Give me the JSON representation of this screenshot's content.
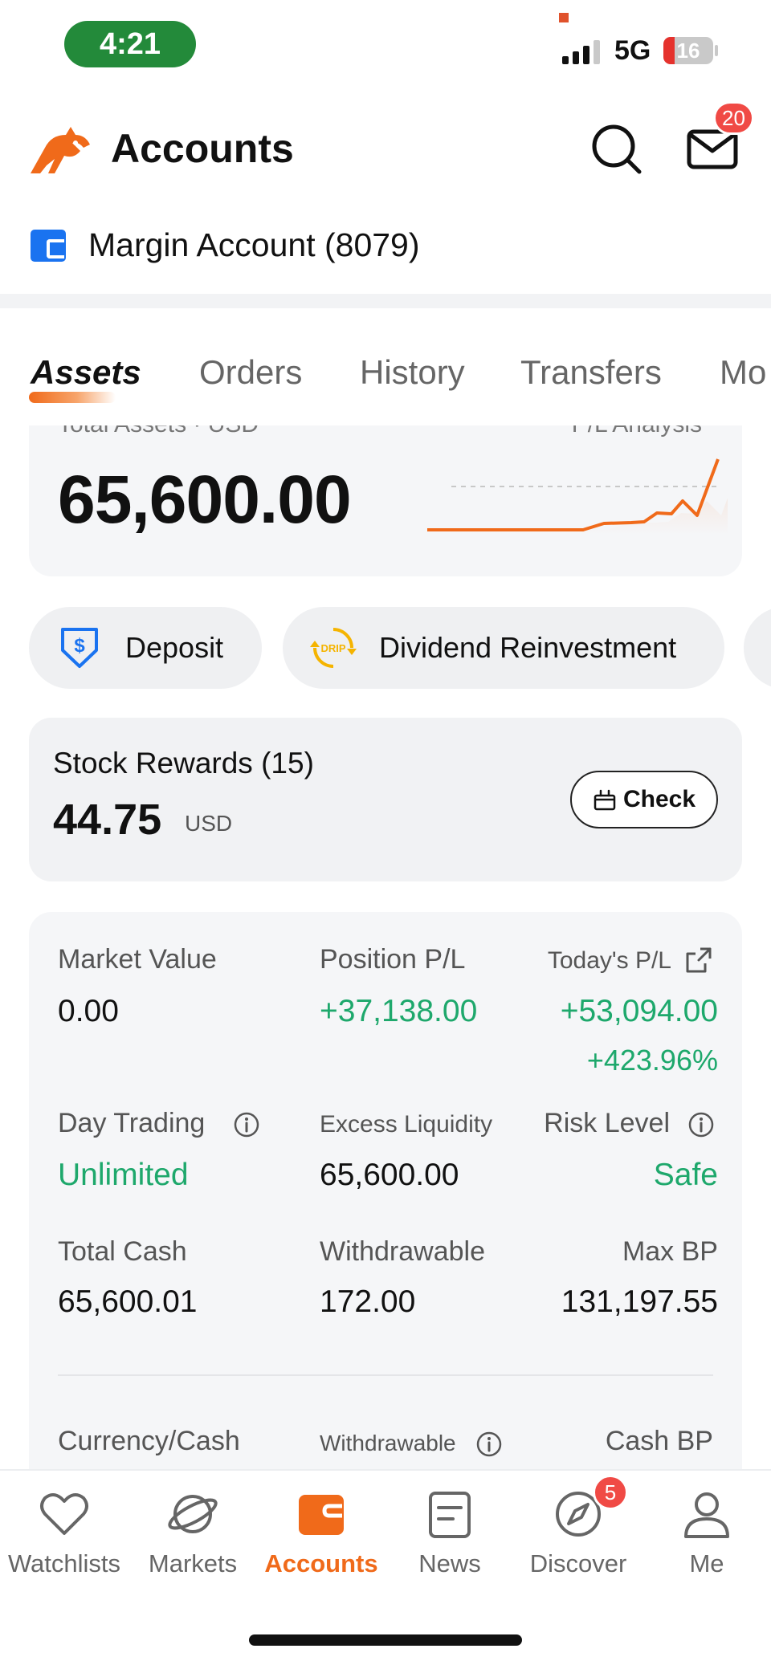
{
  "status_bar": {
    "time": "4:21",
    "network": "5G",
    "battery": "16"
  },
  "header": {
    "title": "Accounts",
    "mail_badge": "20"
  },
  "account": {
    "label": "Margin Account (8079)"
  },
  "tabs": [
    {
      "label": "Assets",
      "active": true
    },
    {
      "label": "Orders",
      "active": false
    },
    {
      "label": "History",
      "active": false
    },
    {
      "label": "Transfers",
      "active": false
    },
    {
      "label": "Mo",
      "active": false
    }
  ],
  "assets_card": {
    "total_label": "Total Assets · USD",
    "analysis_label": "P/L Analysis",
    "total_value": "65,600.00"
  },
  "quick_actions": [
    {
      "label": "Deposit",
      "icon": "deposit-icon"
    },
    {
      "label": "Dividend Reinvestment",
      "icon": "drip-icon",
      "icon_text": "DRIP"
    }
  ],
  "stock_rewards": {
    "title": "Stock Rewards (15)",
    "amount": "44.75",
    "currency": "USD",
    "button_label": "Check"
  },
  "metrics": {
    "market_value": {
      "label": "Market Value",
      "value": "0.00"
    },
    "position_pl": {
      "label": "Position P/L",
      "value": "+37,138.00"
    },
    "todays_pl": {
      "label": "Today's P/L",
      "value": "+53,094.00",
      "percent": "+423.96%"
    },
    "day_trading": {
      "label": "Day Trading",
      "value": "Unlimited"
    },
    "excess_liquidity": {
      "label": "Excess Liquidity",
      "value": "65,600.00"
    },
    "risk_level": {
      "label": "Risk Level",
      "value": "Safe"
    },
    "total_cash": {
      "label": "Total Cash",
      "value": "65,600.01"
    },
    "withdrawable": {
      "label": "Withdrawable",
      "value": "172.00"
    },
    "max_bp": {
      "label": "Max BP",
      "value": "131,197.55"
    },
    "currency_cash": {
      "label": "Currency/Cash"
    },
    "withdrawable_2": {
      "label": "Withdrawable"
    },
    "cash_bp": {
      "label": "Cash BP"
    }
  },
  "bottom_nav": [
    {
      "label": "Watchlists",
      "icon": "heart-icon",
      "active": false
    },
    {
      "label": "Markets",
      "icon": "planet-icon",
      "active": false
    },
    {
      "label": "Accounts",
      "icon": "wallet-icon",
      "active": true
    },
    {
      "label": "News",
      "icon": "news-icon",
      "active": false
    },
    {
      "label": "Discover",
      "icon": "compass-icon",
      "active": false,
      "badge": "5"
    },
    {
      "label": "Me",
      "icon": "person-icon",
      "active": false
    }
  ],
  "colors": {
    "accent": "#f06a1a",
    "positive": "#1ea86c",
    "badge": "#f04a45",
    "account_icon": "#1a73f0"
  }
}
